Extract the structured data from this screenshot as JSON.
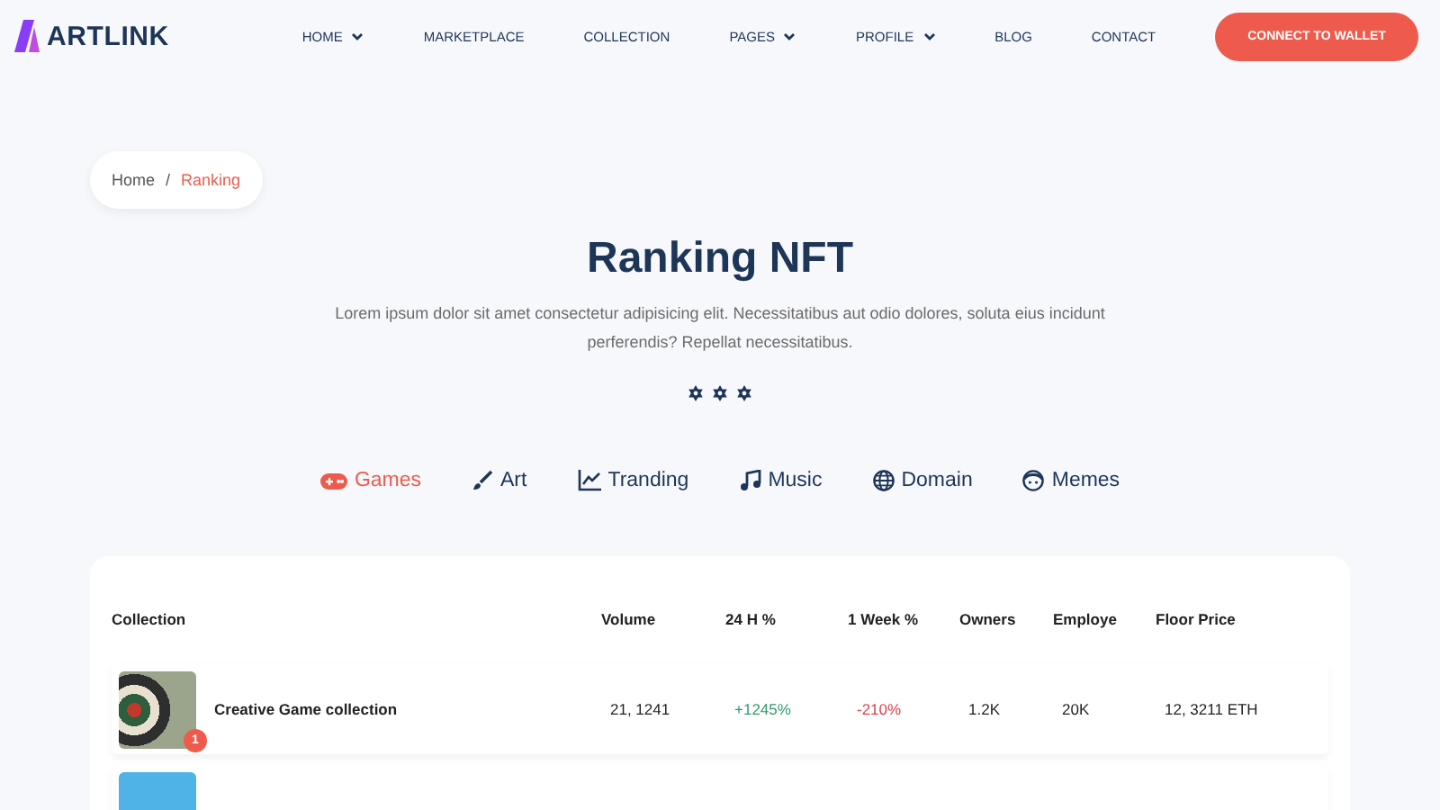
{
  "logo": {
    "text": "ARTLINK"
  },
  "nav": [
    {
      "label": "HOME",
      "dropdown": true
    },
    {
      "label": "MARKETPLACE",
      "dropdown": false
    },
    {
      "label": "COLLECTION",
      "dropdown": false
    },
    {
      "label": "PAGES",
      "dropdown": true
    },
    {
      "label": "PROFILE",
      "dropdown": true
    },
    {
      "label": "BLOG",
      "dropdown": false
    },
    {
      "label": "CONTACT",
      "dropdown": false
    }
  ],
  "cta_button": "CONNECT TO WALLET",
  "breadcrumb": [
    {
      "label": "Home",
      "selected": false
    },
    {
      "label": "Ranking",
      "selected": true
    }
  ],
  "breadcrumb_separator": "/",
  "hero": {
    "title": "Ranking NFT",
    "description": "Lorem ipsum dolor sit amet consectetur adipisicing elit. Necessitatibus aut odio dolores, soluta eius incidunt perferendis? Repellat necessitatibus."
  },
  "categories": [
    {
      "label": "Games",
      "kind": "gamepad",
      "selected": true
    },
    {
      "label": "Art",
      "kind": "brush",
      "selected": false
    },
    {
      "label": "Tranding",
      "kind": "chart",
      "selected": false
    },
    {
      "label": "Music",
      "kind": "music",
      "selected": false
    },
    {
      "label": "Domain",
      "kind": "globe",
      "selected": false
    },
    {
      "label": "Memes",
      "kind": "face",
      "selected": false
    }
  ],
  "table": {
    "columns": [
      "Collection",
      "Volume",
      "24 H %",
      "1 Week %",
      "Owners",
      "Employe",
      "Floor Price"
    ],
    "rows": [
      {
        "rank": "1",
        "name": "Creative Game collection",
        "volume": "21, 1241",
        "day_change": "+1245%",
        "week_change": "-210%",
        "owners": "1.2K",
        "employe": "20K",
        "floor_price": "12, 3211 ETH"
      },
      {
        "rank": null,
        "name": null,
        "volume": null,
        "day_change": null,
        "week_change": null,
        "owners": null,
        "employe": null,
        "floor_price": null
      }
    ]
  }
}
